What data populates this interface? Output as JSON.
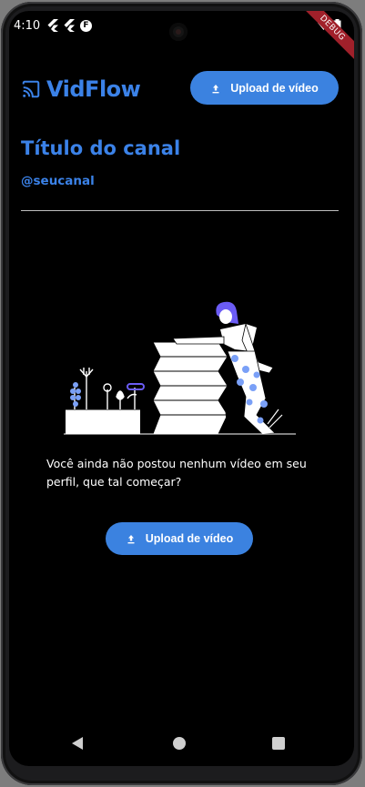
{
  "status_bar": {
    "time": "4:10",
    "debug_label": "DEBUG"
  },
  "header": {
    "app_name": "VidFlow",
    "upload_label": "Upload de vídeo"
  },
  "channel": {
    "title": "Título do canal",
    "handle": "@seucanal"
  },
  "empty_state": {
    "message": "Você ainda não postou nenhum vídeo em seu perfil, que tal começar?",
    "upload_label": "Upload de vídeo"
  },
  "colors": {
    "accent": "#3b82e8",
    "button": "#3b82e0",
    "background": "#000000"
  }
}
